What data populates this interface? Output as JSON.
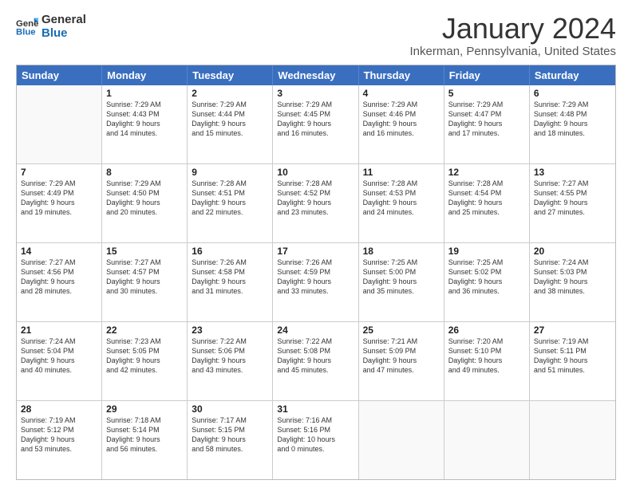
{
  "logo": {
    "line1": "General",
    "line2": "Blue"
  },
  "title": "January 2024",
  "location": "Inkerman, Pennsylvania, United States",
  "days_header": [
    "Sunday",
    "Monday",
    "Tuesday",
    "Wednesday",
    "Thursday",
    "Friday",
    "Saturday"
  ],
  "weeks": [
    [
      {
        "day": "",
        "info": ""
      },
      {
        "day": "1",
        "info": "Sunrise: 7:29 AM\nSunset: 4:43 PM\nDaylight: 9 hours\nand 14 minutes."
      },
      {
        "day": "2",
        "info": "Sunrise: 7:29 AM\nSunset: 4:44 PM\nDaylight: 9 hours\nand 15 minutes."
      },
      {
        "day": "3",
        "info": "Sunrise: 7:29 AM\nSunset: 4:45 PM\nDaylight: 9 hours\nand 16 minutes."
      },
      {
        "day": "4",
        "info": "Sunrise: 7:29 AM\nSunset: 4:46 PM\nDaylight: 9 hours\nand 16 minutes."
      },
      {
        "day": "5",
        "info": "Sunrise: 7:29 AM\nSunset: 4:47 PM\nDaylight: 9 hours\nand 17 minutes."
      },
      {
        "day": "6",
        "info": "Sunrise: 7:29 AM\nSunset: 4:48 PM\nDaylight: 9 hours\nand 18 minutes."
      }
    ],
    [
      {
        "day": "7",
        "info": "Sunrise: 7:29 AM\nSunset: 4:49 PM\nDaylight: 9 hours\nand 19 minutes."
      },
      {
        "day": "8",
        "info": "Sunrise: 7:29 AM\nSunset: 4:50 PM\nDaylight: 9 hours\nand 20 minutes."
      },
      {
        "day": "9",
        "info": "Sunrise: 7:28 AM\nSunset: 4:51 PM\nDaylight: 9 hours\nand 22 minutes."
      },
      {
        "day": "10",
        "info": "Sunrise: 7:28 AM\nSunset: 4:52 PM\nDaylight: 9 hours\nand 23 minutes."
      },
      {
        "day": "11",
        "info": "Sunrise: 7:28 AM\nSunset: 4:53 PM\nDaylight: 9 hours\nand 24 minutes."
      },
      {
        "day": "12",
        "info": "Sunrise: 7:28 AM\nSunset: 4:54 PM\nDaylight: 9 hours\nand 25 minutes."
      },
      {
        "day": "13",
        "info": "Sunrise: 7:27 AM\nSunset: 4:55 PM\nDaylight: 9 hours\nand 27 minutes."
      }
    ],
    [
      {
        "day": "14",
        "info": "Sunrise: 7:27 AM\nSunset: 4:56 PM\nDaylight: 9 hours\nand 28 minutes."
      },
      {
        "day": "15",
        "info": "Sunrise: 7:27 AM\nSunset: 4:57 PM\nDaylight: 9 hours\nand 30 minutes."
      },
      {
        "day": "16",
        "info": "Sunrise: 7:26 AM\nSunset: 4:58 PM\nDaylight: 9 hours\nand 31 minutes."
      },
      {
        "day": "17",
        "info": "Sunrise: 7:26 AM\nSunset: 4:59 PM\nDaylight: 9 hours\nand 33 minutes."
      },
      {
        "day": "18",
        "info": "Sunrise: 7:25 AM\nSunset: 5:00 PM\nDaylight: 9 hours\nand 35 minutes."
      },
      {
        "day": "19",
        "info": "Sunrise: 7:25 AM\nSunset: 5:02 PM\nDaylight: 9 hours\nand 36 minutes."
      },
      {
        "day": "20",
        "info": "Sunrise: 7:24 AM\nSunset: 5:03 PM\nDaylight: 9 hours\nand 38 minutes."
      }
    ],
    [
      {
        "day": "21",
        "info": "Sunrise: 7:24 AM\nSunset: 5:04 PM\nDaylight: 9 hours\nand 40 minutes."
      },
      {
        "day": "22",
        "info": "Sunrise: 7:23 AM\nSunset: 5:05 PM\nDaylight: 9 hours\nand 42 minutes."
      },
      {
        "day": "23",
        "info": "Sunrise: 7:22 AM\nSunset: 5:06 PM\nDaylight: 9 hours\nand 43 minutes."
      },
      {
        "day": "24",
        "info": "Sunrise: 7:22 AM\nSunset: 5:08 PM\nDaylight: 9 hours\nand 45 minutes."
      },
      {
        "day": "25",
        "info": "Sunrise: 7:21 AM\nSunset: 5:09 PM\nDaylight: 9 hours\nand 47 minutes."
      },
      {
        "day": "26",
        "info": "Sunrise: 7:20 AM\nSunset: 5:10 PM\nDaylight: 9 hours\nand 49 minutes."
      },
      {
        "day": "27",
        "info": "Sunrise: 7:19 AM\nSunset: 5:11 PM\nDaylight: 9 hours\nand 51 minutes."
      }
    ],
    [
      {
        "day": "28",
        "info": "Sunrise: 7:19 AM\nSunset: 5:12 PM\nDaylight: 9 hours\nand 53 minutes."
      },
      {
        "day": "29",
        "info": "Sunrise: 7:18 AM\nSunset: 5:14 PM\nDaylight: 9 hours\nand 56 minutes."
      },
      {
        "day": "30",
        "info": "Sunrise: 7:17 AM\nSunset: 5:15 PM\nDaylight: 9 hours\nand 58 minutes."
      },
      {
        "day": "31",
        "info": "Sunrise: 7:16 AM\nSunset: 5:16 PM\nDaylight: 10 hours\nand 0 minutes."
      },
      {
        "day": "",
        "info": ""
      },
      {
        "day": "",
        "info": ""
      },
      {
        "day": "",
        "info": ""
      }
    ]
  ]
}
